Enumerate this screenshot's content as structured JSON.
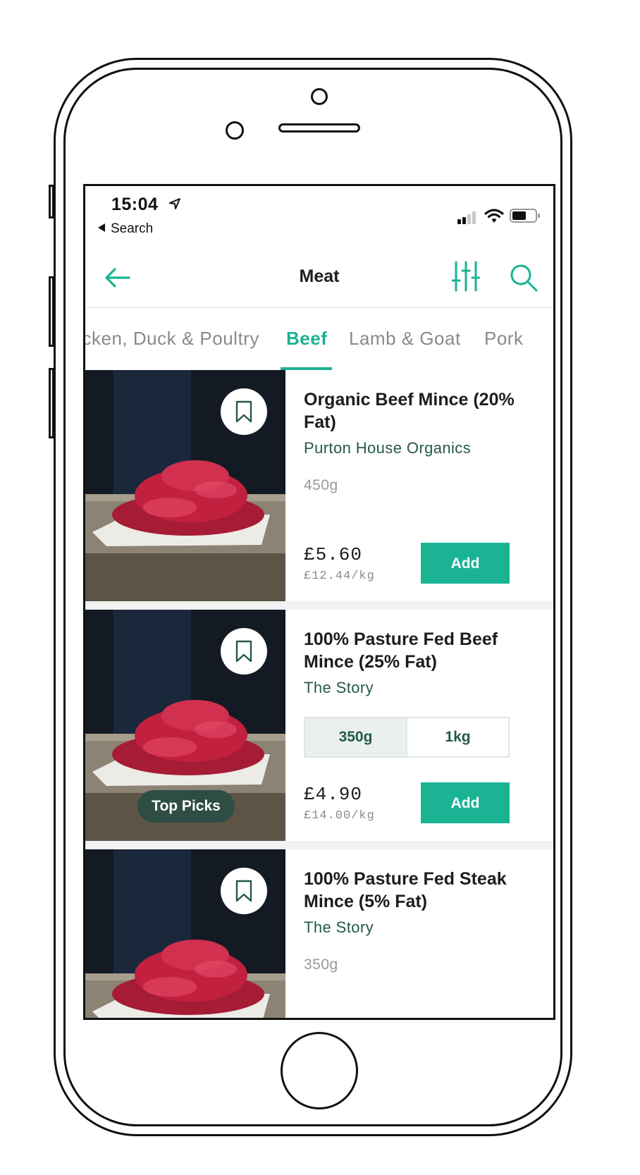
{
  "status_bar": {
    "time": "15:04",
    "back_app": "Search"
  },
  "nav": {
    "title": "Meat"
  },
  "tabs": [
    {
      "label": "Chicken, Duck & Poultry"
    },
    {
      "label": "Beef"
    },
    {
      "label": "Lamb & Goat"
    },
    {
      "label": "Pork"
    }
  ],
  "active_tab": "Beef",
  "products": [
    {
      "title": "Organic Beef Mince (20% Fat)",
      "brand": "Purton House Organics",
      "weight": "450g",
      "price": "£5.60",
      "unit_price": "£12.44/kg",
      "add_label": "Add"
    },
    {
      "title": "100% Pasture Fed Beef Mince (25% Fat)",
      "brand": "The Story",
      "sizes": [
        "350g",
        "1kg"
      ],
      "selected_size": "350g",
      "price": "£4.90",
      "unit_price": "£14.00/kg",
      "add_label": "Add",
      "badge": "Top Picks"
    },
    {
      "title": "100% Pasture Fed Steak Mince (5% Fat)",
      "brand": "The Story",
      "weight": "350g"
    }
  ],
  "colors": {
    "accent": "#1ab394",
    "brand_text": "#24594c",
    "badge_bg": "#2e4d45"
  },
  "icons": [
    "location-arrow-icon",
    "back-arrow-icon",
    "filter-sliders-icon",
    "search-icon",
    "bookmark-icon",
    "signal-icon",
    "wifi-icon",
    "battery-icon"
  ]
}
